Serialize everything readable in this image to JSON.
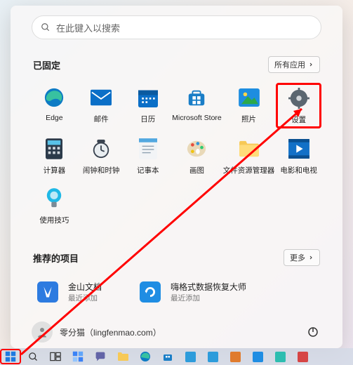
{
  "search": {
    "placeholder": "在此键入以搜索"
  },
  "pinned": {
    "title": "已固定",
    "all_apps": "所有应用",
    "tiles": [
      {
        "name": "edge",
        "label": "Edge"
      },
      {
        "name": "mail",
        "label": "邮件"
      },
      {
        "name": "calendar",
        "label": "日历"
      },
      {
        "name": "store",
        "label": "Microsoft Store"
      },
      {
        "name": "photos",
        "label": "照片"
      },
      {
        "name": "settings",
        "label": "设置"
      },
      {
        "name": "calculator",
        "label": "计算器"
      },
      {
        "name": "clock",
        "label": "闹钟和时钟"
      },
      {
        "name": "notepad",
        "label": "记事本"
      },
      {
        "name": "paint",
        "label": "画图"
      },
      {
        "name": "explorer",
        "label": "文件资源管理器"
      },
      {
        "name": "movies",
        "label": "电影和电视"
      },
      {
        "name": "tips",
        "label": "使用技巧"
      }
    ]
  },
  "recommended": {
    "title": "推荐的项目",
    "more": "更多",
    "items": [
      {
        "name": "wps",
        "title": "金山文档",
        "sub": "最近添加"
      },
      {
        "name": "recovery",
        "title": "嗨格式数据恢复大师",
        "sub": "最近添加"
      }
    ]
  },
  "user": {
    "name": "零分猫（lingfenmao.com）"
  }
}
